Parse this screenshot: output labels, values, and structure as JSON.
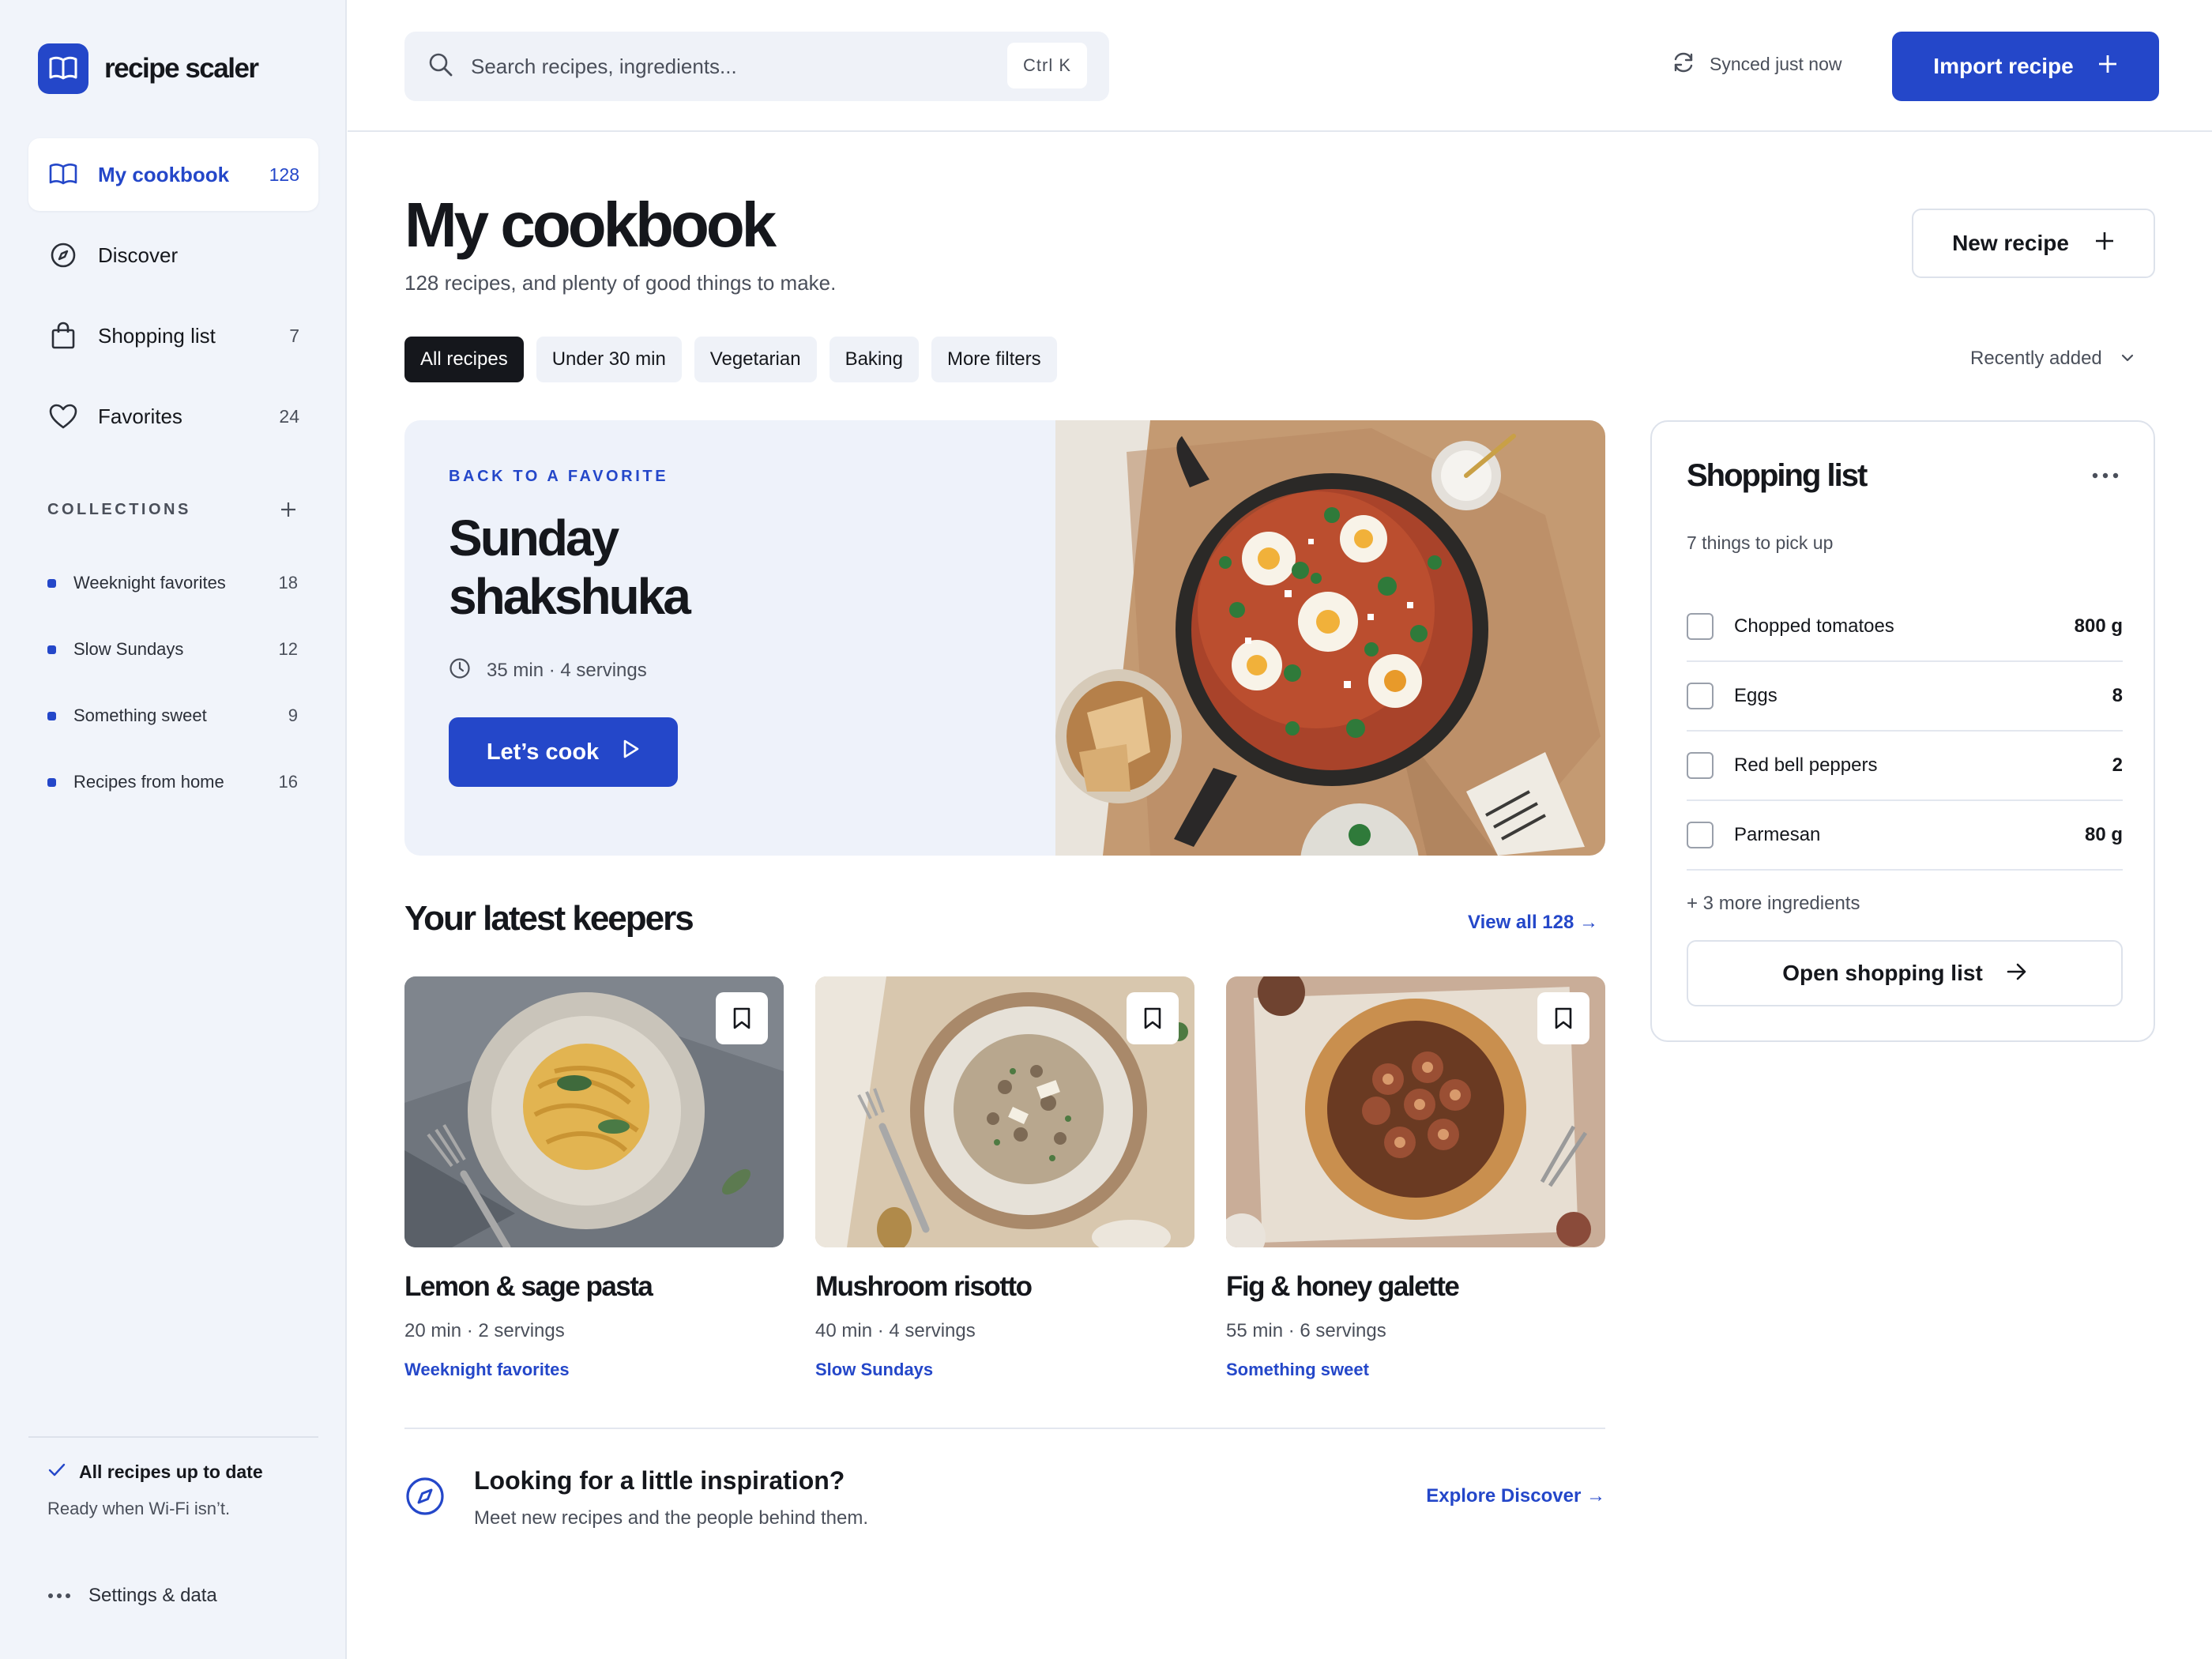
{
  "brand": {
    "name": "recipe scaler"
  },
  "sidebar": {
    "nav": [
      {
        "label": "My cookbook",
        "count": "128",
        "active": true
      },
      {
        "label": "Discover",
        "count": ""
      },
      {
        "label": "Shopping list",
        "count": "7"
      },
      {
        "label": "Favorites",
        "count": "24"
      }
    ],
    "collections_title": "COLLECTIONS",
    "collections": [
      {
        "name": "Weeknight favorites",
        "count": "18"
      },
      {
        "name": "Slow Sundays",
        "count": "12"
      },
      {
        "name": "Something sweet",
        "count": "9"
      },
      {
        "name": "Recipes from home",
        "count": "16"
      }
    ],
    "status_title": "All recipes up to date",
    "status_sub": "Ready when Wi-Fi isn’t.",
    "settings_label": "Settings & data"
  },
  "topbar": {
    "search_placeholder": "Search recipes, ingredients...",
    "search_shortcut": "Ctrl K",
    "sync_text": "Synced just now",
    "import_label": "Import recipe"
  },
  "main": {
    "title": "My cookbook",
    "subtitle": "128 recipes, and plenty of good things to make.",
    "new_recipe_label": "New recipe",
    "filters": [
      {
        "label": "All recipes",
        "active": true
      },
      {
        "label": "Under 30 min"
      },
      {
        "label": "Vegetarian"
      },
      {
        "label": "Baking"
      },
      {
        "label": "More filters"
      }
    ],
    "sort_label": "Recently added"
  },
  "hero": {
    "eyebrow": "BACK TO A FAVORITE",
    "title_line1": "Sunday",
    "title_line2": "shakshuka",
    "meta": "35 min · 4 servings",
    "cta": "Let’s cook"
  },
  "shopping": {
    "title": "Shopping list",
    "subtitle": "7 things to pick up",
    "items": [
      {
        "name": "Chopped tomatoes",
        "qty": "800 g"
      },
      {
        "name": "Eggs",
        "qty": "8"
      },
      {
        "name": "Red bell peppers",
        "qty": "2"
      },
      {
        "name": "Parmesan",
        "qty": "80 g"
      }
    ],
    "more": "+ 3 more ingredients",
    "open_label": "Open shopping list"
  },
  "keepers": {
    "title": "Your latest keepers",
    "view_all": "View all 128 →",
    "cards": [
      {
        "title": "Lemon & sage pasta",
        "meta": "20 min · 2 servings",
        "tag": "Weeknight favorites"
      },
      {
        "title": "Mushroom risotto",
        "meta": "40 min · 4 servings",
        "tag": "Slow Sundays"
      },
      {
        "title": "Fig & honey galette",
        "meta": "55 min · 6 servings",
        "tag": "Something sweet"
      }
    ]
  },
  "inspiration": {
    "title": "Looking for a little inspiration?",
    "subtitle": "Meet new recipes and the people behind them.",
    "link": "Explore Discover →"
  },
  "colors": {
    "accent": "#2447c9",
    "sidebar_bg": "#f1f4fa",
    "text": "#15171c",
    "muted": "#4a4f5a"
  }
}
